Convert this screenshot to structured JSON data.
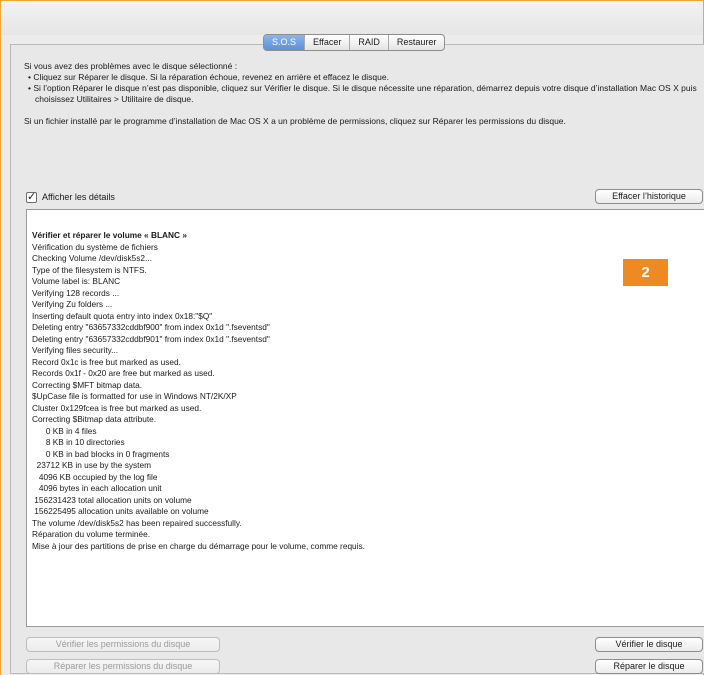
{
  "tabs": [
    {
      "label": "S.O.S",
      "active": true
    },
    {
      "label": "Effacer",
      "active": false
    },
    {
      "label": "RAID",
      "active": false
    },
    {
      "label": "Restaurer",
      "active": false
    }
  ],
  "description": {
    "line1": "Si vous avez des problèmes avec le disque sélectionné :",
    "bullet1": "• Cliquez sur Réparer le disque. Si la réparation échoue, revenez en arrière et effacez le disque.",
    "bullet2": "• Si l’option Réparer le disque n’est pas disponible, cliquez sur Vérifier le disque. Si le disque nécessite une réparation, démarrez depuis votre disque d’installation Mac OS X puis choisissez Utilitaires > Utilitaire de disque.",
    "para2": "Si un fichier installé par le programme d’installation de Mac OS X a un problème de permissions, cliquez sur Réparer les permissions du disque."
  },
  "details": {
    "checkbox_label": "Afficher les détails",
    "checked": true,
    "clear_history_button": "Effacer l’historique"
  },
  "log": {
    "lines": [
      {
        "text": "Vérifier et réparer le volume « BLANC »",
        "bold": true
      },
      {
        "text": "Vérification du système de fichiers"
      },
      {
        "text": "Checking Volume /dev/disk5s2..."
      },
      {
        "text": "Type of the filesystem is NTFS."
      },
      {
        "text": "Volume label is: BLANC"
      },
      {
        "text": "Verifying 128 records ..."
      },
      {
        "text": "Verifying Zu folders ..."
      },
      {
        "text": "Inserting default quota entry into index 0x18:\"$Q\""
      },
      {
        "text": "Deleting entry \"63657332cddbf900\" from index 0x1d \".fseventsd\""
      },
      {
        "text": "Deleting entry \"63657332cddbf901\" from index 0x1d \".fseventsd\""
      },
      {
        "text": "Verifying files security..."
      },
      {
        "text": "Record 0x1c is free but marked as used."
      },
      {
        "text": "Records 0x1f - 0x20 are free but marked as used."
      },
      {
        "text": "Correcting $MFT bitmap data."
      },
      {
        "text": "$UpCase file is formatted for use in Windows NT/2K/XP"
      },
      {
        "text": "Cluster 0x129fcea is free but marked as used."
      },
      {
        "text": "Correcting $Bitmap data attribute."
      },
      {
        "text": "      0 KB in 4 files"
      },
      {
        "text": "      8 KB in 10 directories"
      },
      {
        "text": "      0 KB in bad blocks in 0 fragments"
      },
      {
        "text": "  23712 KB in use by the system"
      },
      {
        "text": "   4096 KB occupied by the log file"
      },
      {
        "text": "   4096 bytes in each allocation unit"
      },
      {
        "text": " 156231423 total allocation units on volume"
      },
      {
        "text": " 156225495 allocation units available on volume"
      },
      {
        "text": "The volume /dev/disk5s2 has been repaired successfully."
      },
      {
        "text": "Réparation du volume terminée."
      },
      {
        "text": "Mise à jour des partitions de prise en charge du démarrage pour le volume, comme requis."
      }
    ]
  },
  "badge": {
    "label": "2",
    "color": "#ef8a23"
  },
  "buttons": {
    "verify_permissions": "Vérifier les permissions du disque",
    "repair_permissions": "Réparer les permissions du disque",
    "verify_disk": "Vérifier le disque",
    "repair_disk": "Réparer le disque"
  }
}
